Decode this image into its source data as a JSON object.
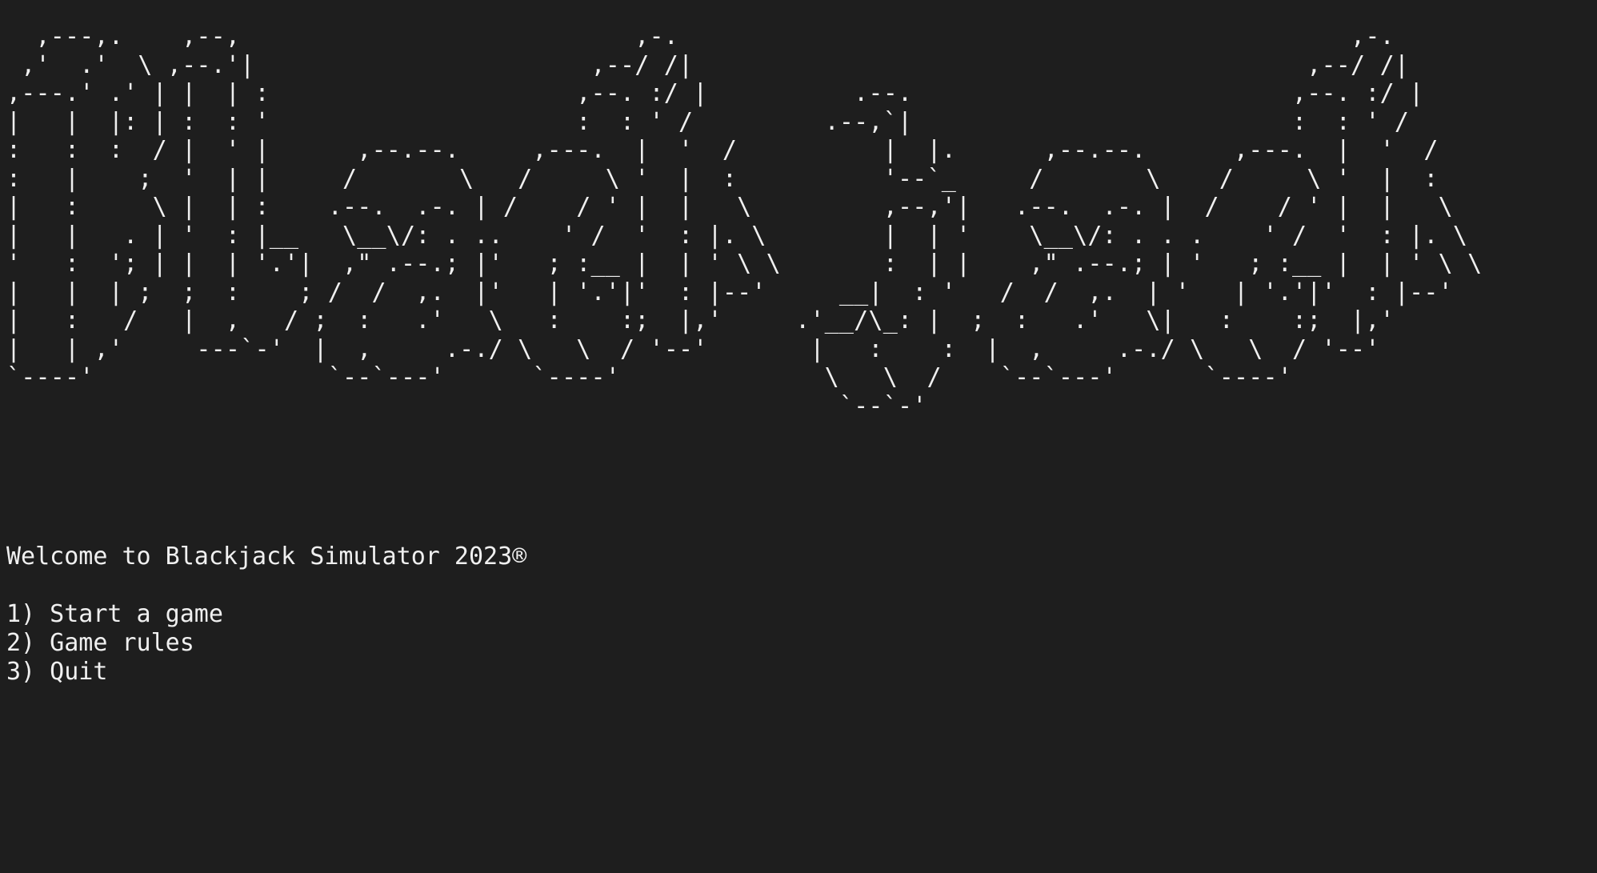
{
  "banner": {
    "ascii_art": "  ,---,.    ,--,                           ,-.                                              ,-.\n ,'  .'  \\ ,--.'|                       ,--/ /|                                          ,--/ /|\n,---.' .' | |  | :                     ,--. :/ |          .--.                          ,--. :/ |\n|   |  |: | :  : '                     :  : ' /         .--,`|                          :  : ' /\n:   :  :  / |  ' |      ,--.--.     ,---.  |  '  /          |  |.      ,--.--.      ,---.  |  '  /\n:   |    ;  '  | |     /       \\   /     \\ '  |  :          '--`_     /       \\    /     \\ '  |  :\n|   :     \\ |  | :    .--.  .-. | /    / ' |  |   \\         ,--,'|   .--.  .-. |  /    / ' |  |   \\\n|   |   . | '  : |__   \\__\\/: . ..    ' /  '  : |. \\        |  | '    \\__\\/: . . .    ' /  '  : |. \\\n'   :  '; | |  | '.'|  ,\" .--.; |'   ; :__ |  | ' \\ \\       :  | |    ,\" .--.; | '   ; :__ |  | ' \\ \\\n|   |  | ;  ;  :    ; /  /  ,.  |'   | '.'|'  : |--'     __|  : '   /  /  ,.  | '   | '.'|'  : |--'\n|   :   /   |  ,   / ;  :   .'   \\   :    :;  |,'     .'__/\\_: |  ;  :   .'   \\|   :    :;  |,'\n|   | ,'     ---`-'  |  ,     .-./ \\   \\  / '--'       |   :    :  |  ,     .-./ \\   \\  / '--'\n`----'                `--`---'      `----'              \\   \\  /    `--`---'      `----'\n                                                         `--`-'"
  },
  "welcome_text": "Welcome to Blackjack Simulator 2023®",
  "menu": {
    "items": [
      {
        "label": "1) Start a game"
      },
      {
        "label": "2) Game rules"
      },
      {
        "label": "3) Quit"
      }
    ]
  },
  "colors": {
    "background": "#1e1e1e",
    "foreground": "#f0f0f0"
  }
}
